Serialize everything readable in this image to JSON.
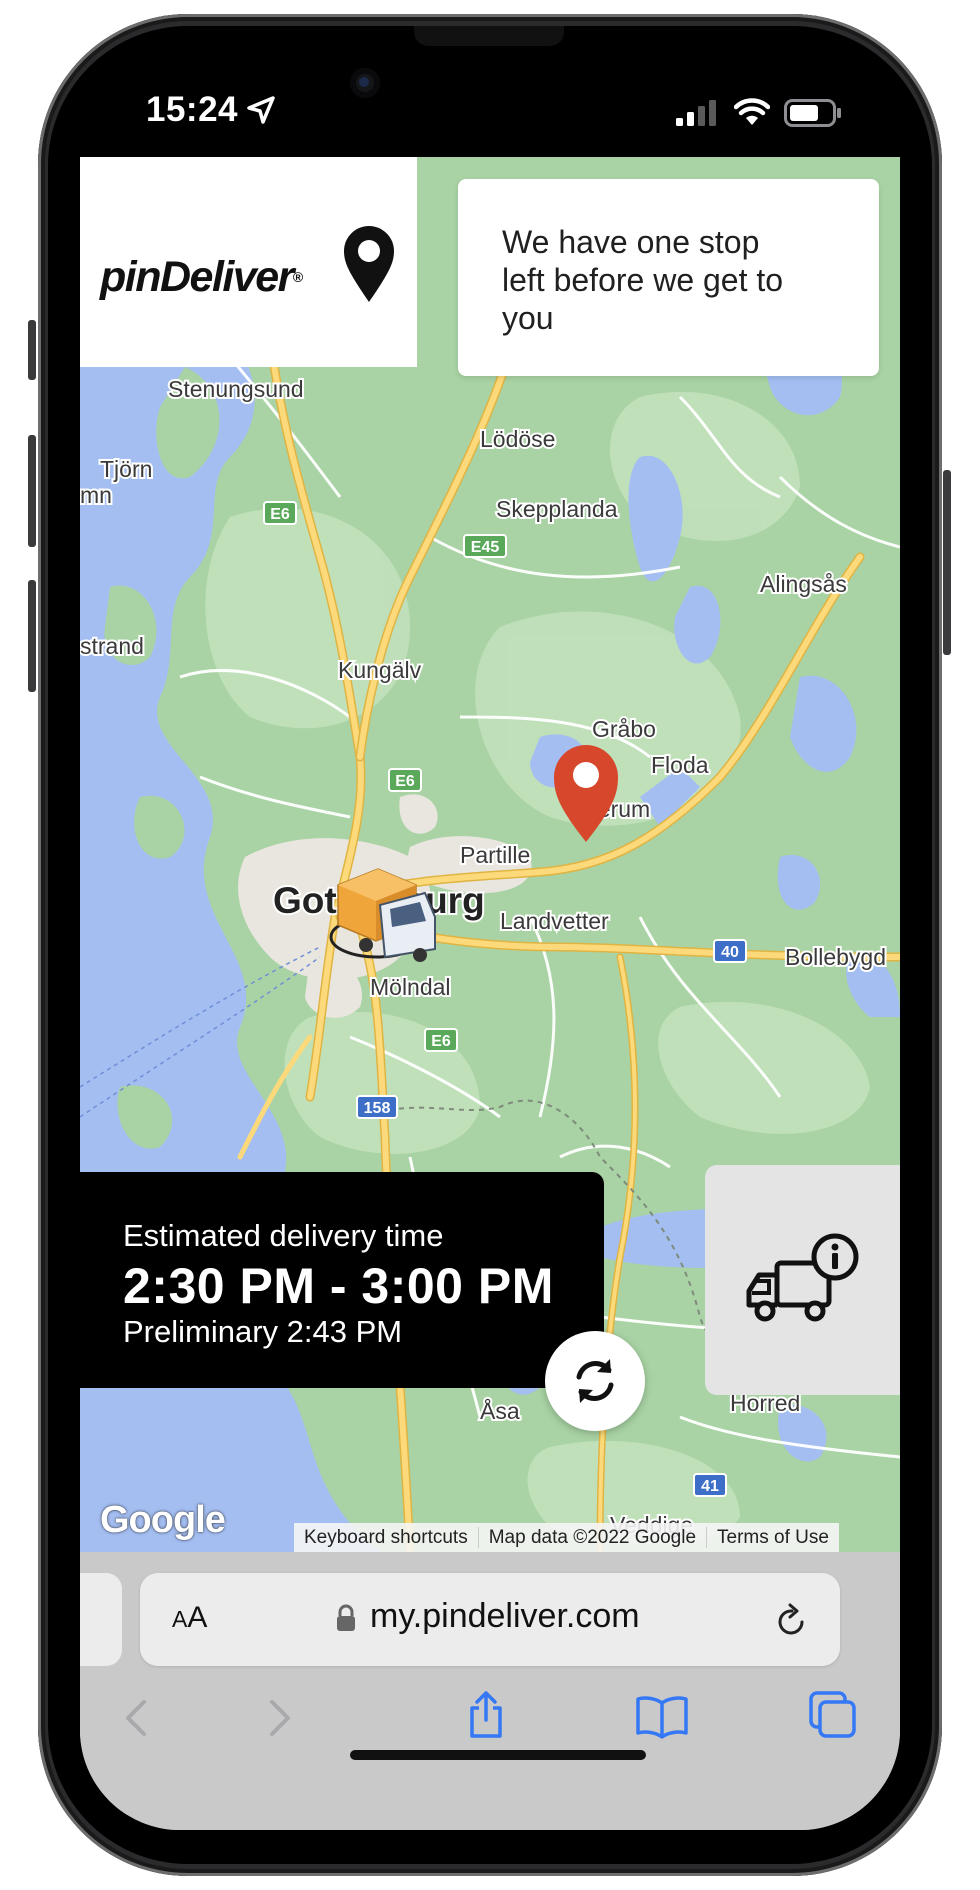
{
  "status_bar": {
    "time": "15:24"
  },
  "header": {
    "brand": "pinDeliver",
    "brand_mark": "®",
    "message": "We have one stop left before we get to you"
  },
  "map": {
    "places": [
      {
        "name": "Stenungsund"
      },
      {
        "name": "Lödöse"
      },
      {
        "name": "Tjörn"
      },
      {
        "name": "Skepplanda"
      },
      {
        "name": "Alingsås"
      },
      {
        "name": "strand"
      },
      {
        "name": "Kungälv"
      },
      {
        "name": "Gråbo"
      },
      {
        "name": "Floda"
      },
      {
        "name": "Partille"
      },
      {
        "name": "Gothenburg"
      },
      {
        "name": "Landvetter"
      },
      {
        "name": "Bollebygd"
      },
      {
        "name": "Mölndal"
      },
      {
        "name": "Åsa"
      },
      {
        "name": "Horred"
      },
      {
        "name": "Veddige"
      },
      {
        "name": "mn"
      },
      {
        "name": "Lerum"
      }
    ],
    "road_shields": [
      "E6",
      "E45",
      "E6",
      "E6",
      "40",
      "158",
      "41"
    ],
    "google_logo": "Google",
    "attribution": [
      "Keyboard shortcuts",
      "Map data ©2022 Google",
      "Terms of Use"
    ]
  },
  "eta": {
    "label": "Estimated delivery time",
    "range": "2:30 PM - 3:00 PM",
    "preliminary": "Preliminary 2:43 PM"
  },
  "browser": {
    "text_size": "AA",
    "url": "my.pindeliver.com"
  },
  "icons": [
    "location-arrow-icon",
    "signal-icon",
    "wifi-icon",
    "battery-icon",
    "map-pin-icon",
    "destination-pin-icon",
    "delivery-truck-icon",
    "refresh-icon",
    "truck-info-icon",
    "lock-icon",
    "reload-icon",
    "back-icon",
    "forward-icon",
    "share-icon",
    "bookmarks-icon",
    "tabs-icon"
  ],
  "colors": {
    "accent": "#d7472b",
    "panel": "#000000",
    "map_land": "#a9d3a4",
    "map_water": "#a4bef2",
    "safari_blue": "#3478f6"
  }
}
